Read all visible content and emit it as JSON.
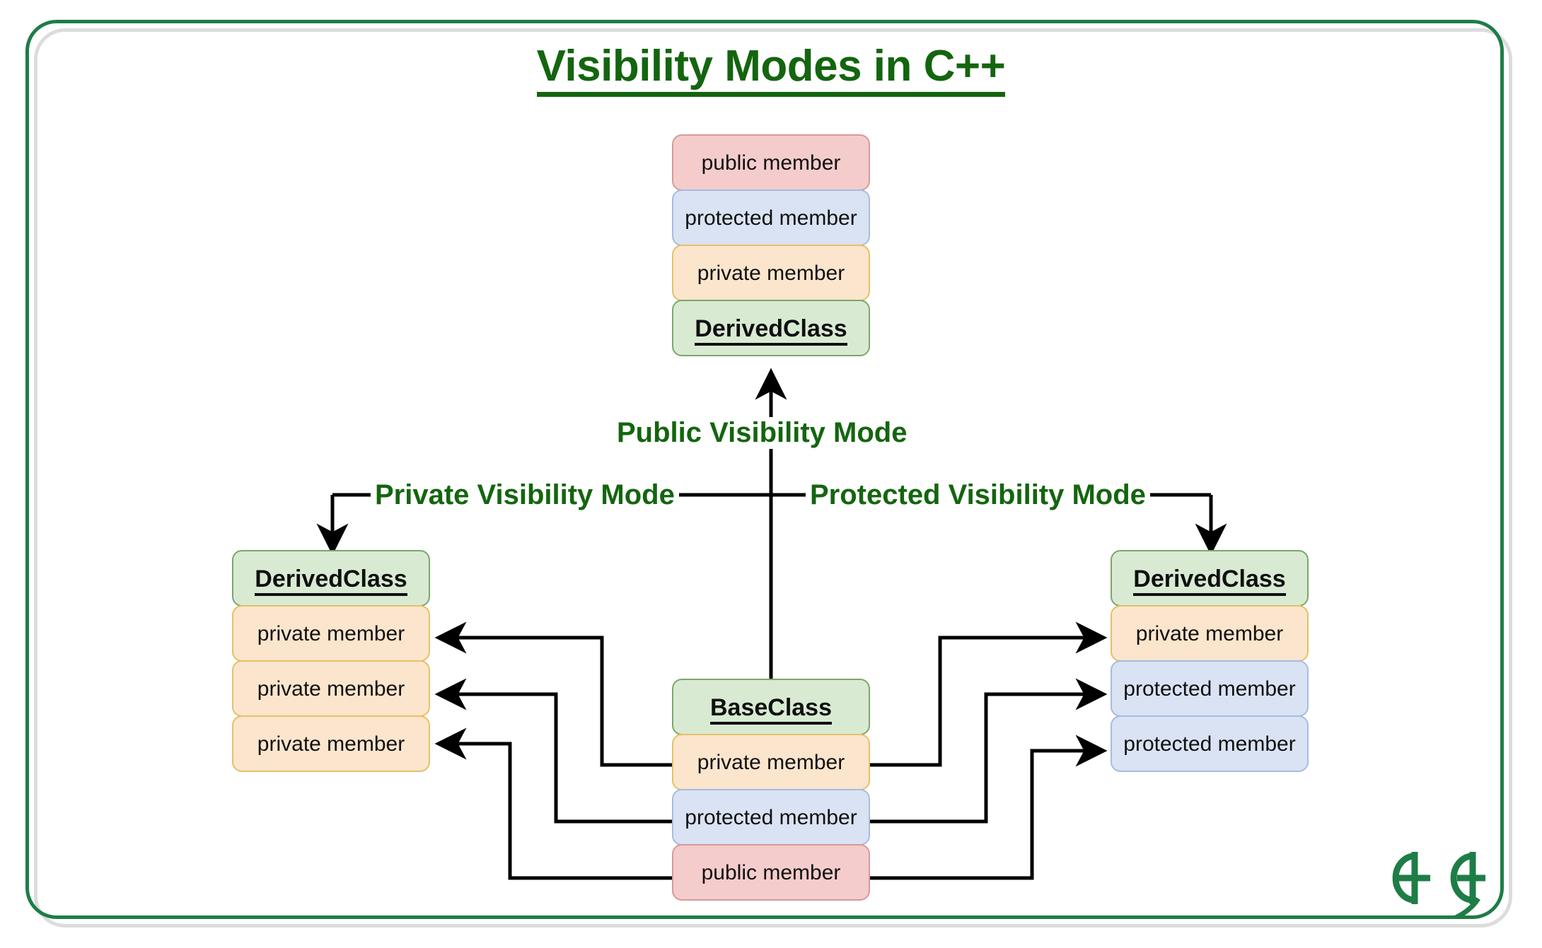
{
  "page": {
    "title": "Visibility Modes in C++",
    "background_color": "#ffffff",
    "frame_color": "#1e7d46",
    "frame_inner_color": "#dcdcdc",
    "title_color": "#14650f"
  },
  "colors": {
    "public": "#f4cccc",
    "protected": "#dae3f3",
    "private": "#fce5cd",
    "class_header": "#d9ead3",
    "connector": "#000000",
    "label": "#14650f"
  },
  "diagram": {
    "type": "class-inheritance-visibility",
    "base_class": {
      "name": "BaseClass",
      "members": [
        {
          "label": "private member",
          "access": "private"
        },
        {
          "label": "protected member",
          "access": "protected"
        },
        {
          "label": "public member",
          "access": "public"
        }
      ]
    },
    "derived_public": {
      "name": "DerivedClass",
      "mode_label": "Public Visibility Mode",
      "members": [
        {
          "label": "public member",
          "access": "public"
        },
        {
          "label": "protected member",
          "access": "protected"
        },
        {
          "label": "private member",
          "access": "private"
        }
      ]
    },
    "derived_private": {
      "name": "DerivedClass",
      "mode_label": "Private Visibility Mode",
      "members": [
        {
          "label": "private member",
          "access": "private"
        },
        {
          "label": "private member",
          "access": "private"
        },
        {
          "label": "private member",
          "access": "private"
        }
      ]
    },
    "derived_protected": {
      "name": "DerivedClass",
      "mode_label": "Protected Visibility Mode",
      "members": [
        {
          "label": "private member",
          "access": "private"
        },
        {
          "label": "protected member",
          "access": "protected"
        },
        {
          "label": "protected member",
          "access": "protected"
        }
      ]
    }
  },
  "logo": {
    "name": "geeksforgeeks-logo",
    "color": "#1e7d46"
  }
}
